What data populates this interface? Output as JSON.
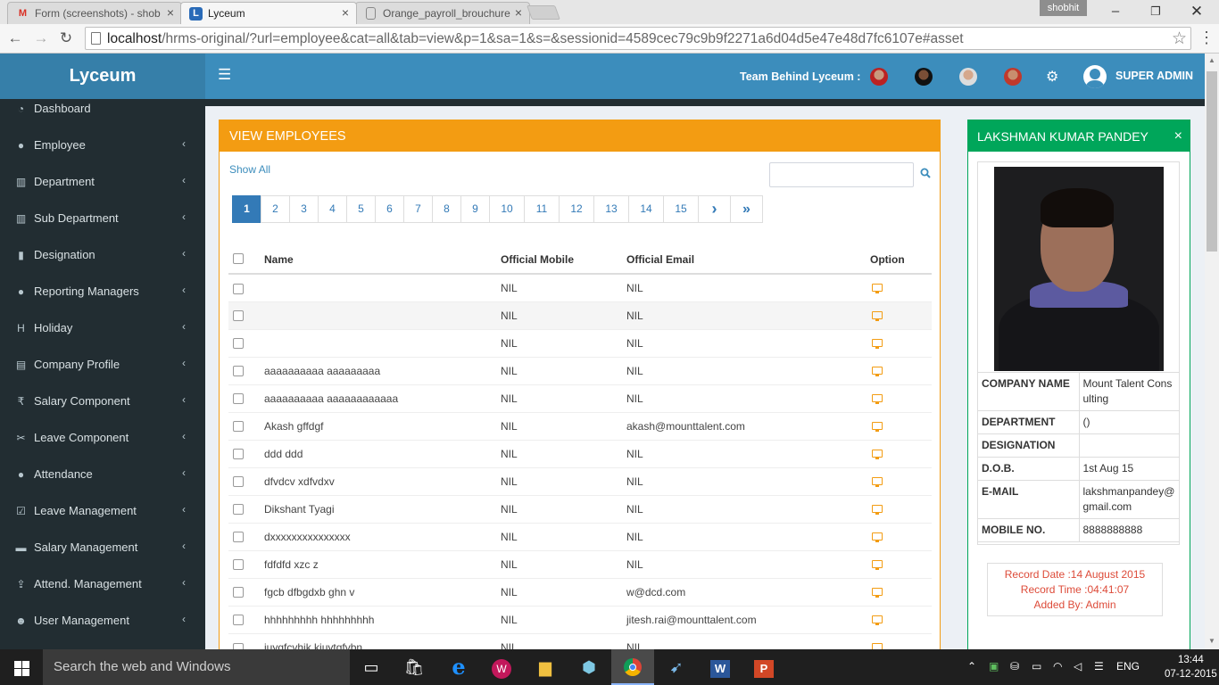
{
  "browser": {
    "tabs": [
      {
        "title": "Form (screenshots) - shob",
        "favicon": "gmail-icon"
      },
      {
        "title": "Lyceum",
        "favicon": "lyceum-icon"
      },
      {
        "title": "Orange_payroll_brouchure",
        "favicon": "doc-icon"
      }
    ],
    "user_chip": "shobhit",
    "url_host": "localhost",
    "url_path": "/hrms-original/?url=employee&cat=all&tab=view&p=1&sa=1&s=&sessionid=4589cec79c9b9f2271a6d04d5e47e48d7fc6107e#asset"
  },
  "app": {
    "logo": "Lyceum",
    "team_label": "Team Behind Lyceum :",
    "admin_name": "SUPER ADMIN"
  },
  "sidebar": {
    "items": [
      {
        "label": "Dashboard",
        "icon": "dashboard-icon"
      },
      {
        "label": "Employee",
        "icon": "user-icon"
      },
      {
        "label": "Department",
        "icon": "bank-icon"
      },
      {
        "label": "Sub Department",
        "icon": "bank-icon"
      },
      {
        "label": "Designation",
        "icon": "bookmark-icon"
      },
      {
        "label": "Reporting Managers",
        "icon": "users-icon"
      },
      {
        "label": "Holiday",
        "icon": "h-square-icon"
      },
      {
        "label": "Company Profile",
        "icon": "building-icon"
      },
      {
        "label": "Salary Component",
        "icon": "rupee-icon"
      },
      {
        "label": "Leave Component",
        "icon": "leave-icon"
      },
      {
        "label": "Attendance",
        "icon": "circle-icon"
      },
      {
        "label": "Leave Management",
        "icon": "check-square-icon"
      },
      {
        "label": "Salary Management",
        "icon": "money-icon"
      },
      {
        "label": "Attend. Management",
        "icon": "upload-icon"
      },
      {
        "label": "User Management",
        "icon": "user-group-icon"
      }
    ]
  },
  "employees": {
    "title": "VIEW EMPLOYEES",
    "show_all": "Show All",
    "search_placeholder": "",
    "pages": [
      "1",
      "2",
      "3",
      "4",
      "5",
      "6",
      "7",
      "8",
      "9",
      "10",
      "11",
      "12",
      "13",
      "14",
      "15"
    ],
    "current_page": "1",
    "columns": {
      "name": "Name",
      "mobile": "Official Mobile",
      "email": "Official Email",
      "option": "Option"
    },
    "rows": [
      {
        "name": "",
        "mobile": "NIL",
        "email": "NIL"
      },
      {
        "name": "",
        "mobile": "NIL",
        "email": "NIL"
      },
      {
        "name": "",
        "mobile": "NIL",
        "email": "NIL"
      },
      {
        "name": "aaaaaaaaaa aaaaaaaaa",
        "mobile": "NIL",
        "email": "NIL"
      },
      {
        "name": "aaaaaaaaaa aaaaaaaaaaaa",
        "mobile": "NIL",
        "email": "NIL"
      },
      {
        "name": "Akash gffdgf",
        "mobile": "NIL",
        "email": "akash@mounttalent.com"
      },
      {
        "name": "ddd ddd",
        "mobile": "NIL",
        "email": "NIL"
      },
      {
        "name": "dfvdcv xdfvdxv",
        "mobile": "NIL",
        "email": "NIL"
      },
      {
        "name": "Dikshant Tyagi",
        "mobile": "NIL",
        "email": "NIL"
      },
      {
        "name": "dxxxxxxxxxxxxxxx",
        "mobile": "NIL",
        "email": "NIL"
      },
      {
        "name": "fdfdfd xzc z",
        "mobile": "NIL",
        "email": "NIL"
      },
      {
        "name": "fgcb dfbgdxb ghn v",
        "mobile": "NIL",
        "email": "w@dcd.com"
      },
      {
        "name": "hhhhhhhhh hhhhhhhhh",
        "mobile": "NIL",
        "email": "jitesh.rai@mounttalent.com"
      },
      {
        "name": "iuygfcvhjk kiuytgfvbn",
        "mobile": "NIL",
        "email": "NIL"
      }
    ]
  },
  "profile": {
    "name": "LAKSHMAN KUMAR PANDEY",
    "fields": [
      {
        "key": "COMPANY NAME",
        "value": "Mount Talent Consulting"
      },
      {
        "key": "DEPARTMENT",
        "value": "()"
      },
      {
        "key": "DESIGNATION",
        "value": ""
      },
      {
        "key": "D.O.B.",
        "value": "1st Aug 15"
      },
      {
        "key": "E-MAIL",
        "value": "lakshmanpandey@gmail.com"
      },
      {
        "key": "MOBILE NO.",
        "value": "8888888888"
      }
    ],
    "record_date": "Record Date :14 August 2015",
    "record_time": "Record Time :04:41:07",
    "added_by": "Added By: Admin"
  },
  "taskbar": {
    "search_placeholder": "Search the web and Windows",
    "language": "ENG",
    "time": "13:44",
    "date": "07-12-2015"
  },
  "colors": {
    "header_blue": "#3c8dbc",
    "logo_blue": "#367fa9",
    "sidebar_dark": "#222d32",
    "employees_orange": "#f39c12",
    "profile_green": "#00a65a",
    "record_red": "#dd4b39"
  }
}
